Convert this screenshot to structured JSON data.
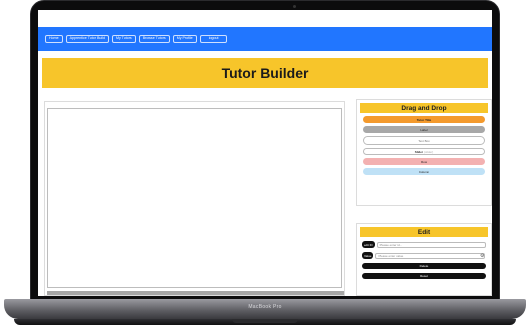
{
  "device": {
    "label": "MacBook Pro"
  },
  "navbar": {
    "items": [
      {
        "label": "Home"
      },
      {
        "label": "Apprentice Tutor Build"
      },
      {
        "label": "My Tutors"
      },
      {
        "label": "Browse Tutors"
      },
      {
        "label": "My Profile"
      },
      {
        "label": "logout"
      }
    ]
  },
  "hero": {
    "title": "Tutor Builder"
  },
  "drag_and_drop": {
    "title": "Drag and Drop",
    "items": [
      {
        "label": "Tutor Title"
      },
      {
        "label": "Label"
      },
      {
        "label": "Text Box"
      },
      {
        "label": "Slider",
        "sublabel": "(slider)"
      },
      {
        "label": "Row"
      },
      {
        "label": "Column"
      }
    ]
  },
  "edit": {
    "title": "Edit",
    "id_tag": "edit ID",
    "id_placeholder": "Please enter id...",
    "value_tag": "Value",
    "value_placeholder": "Please enter value",
    "delete_label": "Delete",
    "reset_label": "Reset"
  },
  "colors": {
    "navbar": "#2176ff",
    "accent": "#f7c52a",
    "tutor_title": "#f49a2d",
    "row": "#f3b1b1",
    "column": "#bfe1f6"
  }
}
